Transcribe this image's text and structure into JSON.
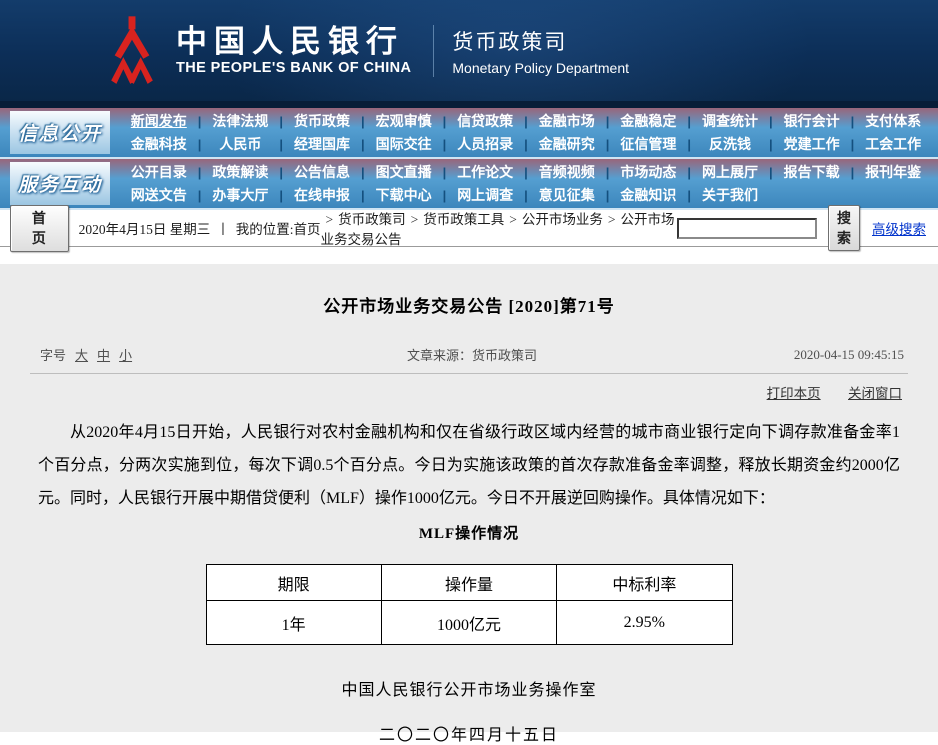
{
  "header": {
    "logo_cn": "中国人民银行",
    "logo_en": "THE PEOPLE'S BANK OF CHINA",
    "dept_cn": "货币政策司",
    "dept_en": "Monetary Policy Department"
  },
  "nav": {
    "rows": [
      {
        "section": "信息公开",
        "active_item": "新闻发布",
        "items_top": [
          "新闻发布",
          "法律法规",
          "货币政策",
          "宏观审慎",
          "信贷政策",
          "金融市场",
          "金融稳定",
          "调查统计",
          "银行会计",
          "支付体系"
        ],
        "items_bottom": [
          "金融科技",
          "人民币",
          "经理国库",
          "国际交往",
          "人员招录",
          "金融研究",
          "征信管理",
          "反洗钱",
          "党建工作",
          "工会工作"
        ]
      },
      {
        "section": "服务互动",
        "active_item": "",
        "items_top": [
          "公开目录",
          "政策解读",
          "公告信息",
          "图文直播",
          "工作论文",
          "音频视频",
          "市场动态",
          "网上展厅",
          "报告下载",
          "报刊年鉴"
        ],
        "items_bottom": [
          "网送文告",
          "办事大厅",
          "在线申报",
          "下载中心",
          "网上调查",
          "意见征集",
          "金融知识",
          "关于我们"
        ]
      }
    ]
  },
  "crumb": {
    "home_button": "首 页",
    "date": "2020年4月15日 星期三",
    "bar_separator": "丨",
    "location_prefix": "我的位置:首页",
    "path": [
      "货币政策司",
      "货币政策工具",
      "公开市场业务",
      "公开市场业务交易公告"
    ],
    "search_value": "",
    "search_button": "搜索",
    "advanced_search": "高级搜索"
  },
  "article": {
    "title": "公开市场业务交易公告 [2020]第71号",
    "font_size_label": "字号",
    "font_sizes": [
      "大",
      "中",
      "小"
    ],
    "source": "文章来源：货币政策司",
    "timestamp": "2020-04-15 09:45:15",
    "print_link": "打印本页",
    "close_link": "关闭窗口",
    "paragraph": "从2020年4月15日开始，人民银行对农村金融机构和仅在省级行政区域内经营的城市商业银行定向下调存款准备金率1个百分点，分两次实施到位，每次下调0.5个百分点。今日为实施该政策的首次存款准备金率调整，释放长期资金约2000亿元。同时，人民银行开展中期借贷便利（MLF）操作1000亿元。今日不开展逆回购操作。具体情况如下：",
    "table_title": "MLF操作情况",
    "table": {
      "headers": [
        "期限",
        "操作量",
        "中标利率"
      ],
      "rows": [
        [
          "1年",
          "1000亿元",
          "2.95%"
        ]
      ]
    },
    "signature": "中国人民银行公开市场业务操作室",
    "sign_date": "二〇二〇年四月十五日"
  },
  "colors": {
    "header_navy": "#0c2e57",
    "nav_blue_top": "#7ab7de",
    "nav_blue_bottom": "#3c86bc",
    "emblem_red": "#d8231f",
    "link_blue": "#0033cc",
    "content_grey": "#ececec"
  }
}
